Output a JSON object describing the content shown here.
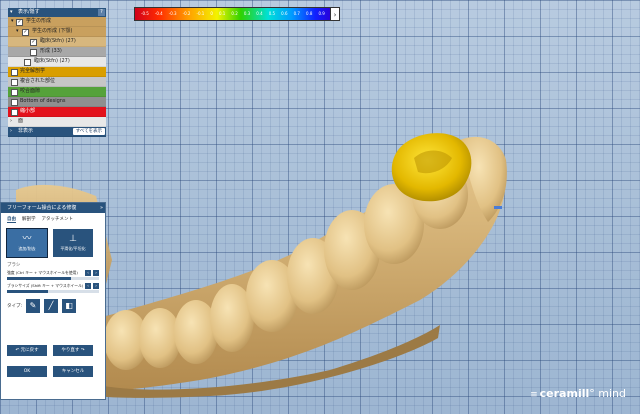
{
  "scale": {
    "ticks": [
      "-0.5",
      "-0.4",
      "-0.3",
      "-0.2",
      "-0.1",
      "0",
      "0.1",
      "0.2",
      "0.3",
      "0.4",
      "0.5",
      "0.6",
      "0.7",
      "0.8",
      "0.9"
    ],
    "button": "›"
  },
  "objects_panel": {
    "title": "表示/隠す",
    "help": "?",
    "rows": [
      {
        "label": "学生の形成",
        "checked": true
      },
      {
        "label": "学生の形成 (下顎)",
        "checked": true
      },
      {
        "label": "臨床(Stfn) (27)",
        "checked": true
      },
      {
        "label": "形成 (33)",
        "checked": false
      },
      {
        "label": "臨床(Stfn) (27)",
        "checked": false
      },
      {
        "label": "完全解剖学",
        "checked": false
      },
      {
        "label": "複合された部位",
        "checked": false
      },
      {
        "label": "咬合面隙",
        "checked": false
      },
      {
        "label": "Bottom of designs",
        "checked": false
      },
      {
        "label": "縮小部",
        "checked": true
      }
    ],
    "collapsed_row": "面",
    "hidden_row": "非表示",
    "show_all": "すべてを表示"
  },
  "freeform_panel": {
    "title": "フリーフォーム操合による修復",
    "close": "»",
    "tabs": [
      "自由",
      "解剖学",
      "アタッチメント"
    ],
    "tools": [
      {
        "icon": "〰",
        "label": "追加/削去"
      },
      {
        "icon": "⊥",
        "label": "平滑化/平坦化"
      }
    ],
    "section": "ブラシ",
    "size_label": "強度 (Ctrl キー + マウスホイールを使用)",
    "size_value": 0.7,
    "smooth_label": "ブラシサイズ (Shift キー + マウスホイール)",
    "smooth_value": 0.45,
    "type_label": "タイプ:",
    "types": [
      "✎",
      "╱",
      "◧"
    ],
    "undo": "元に戻す",
    "redo": "やり直す",
    "ok": "OK",
    "cancel": "キャンセル"
  },
  "logo": {
    "brand": "ceramill",
    "product": "mind"
  }
}
